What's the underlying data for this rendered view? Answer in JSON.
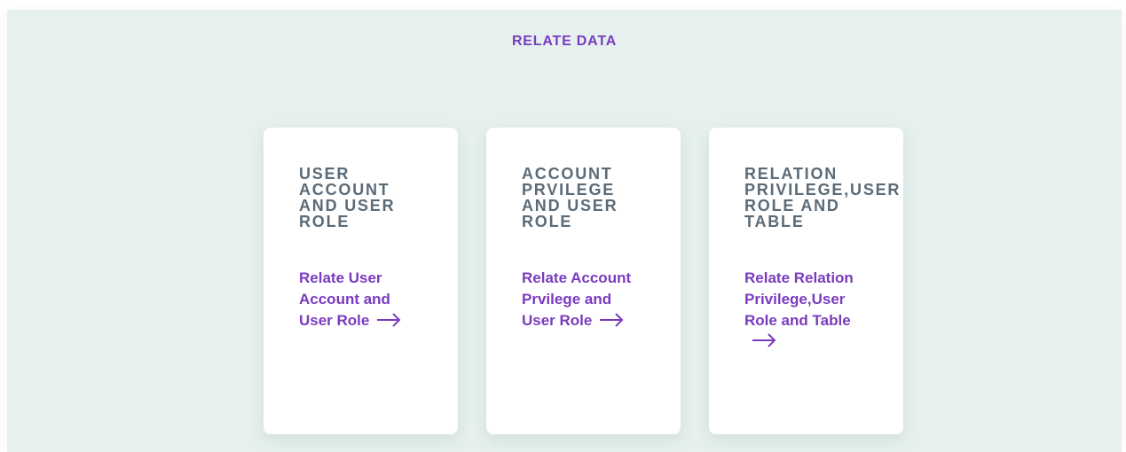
{
  "section": {
    "title": "RELATE DATA"
  },
  "cards": [
    {
      "heading": "USER ACCOUNT AND USER ROLE",
      "link_label": "Relate User Account and User Role",
      "icon": "arrow-right-icon"
    },
    {
      "heading": "ACCOUNT PRVILEGE AND USER ROLE",
      "link_label": "Relate Account Prvilege and User Role",
      "icon": "arrow-right-icon"
    },
    {
      "heading": "RELATION PRIVILEGE,USER ROLE AND TABLE",
      "link_label": "Relate Relation Privilege,User Role and Table",
      "icon": "arrow-right-icon"
    }
  ],
  "colors": {
    "accent": "#7a3bbf",
    "heading": "#5b6b78",
    "panel_background": "#e6f1ef",
    "card_background": "#ffffff"
  }
}
